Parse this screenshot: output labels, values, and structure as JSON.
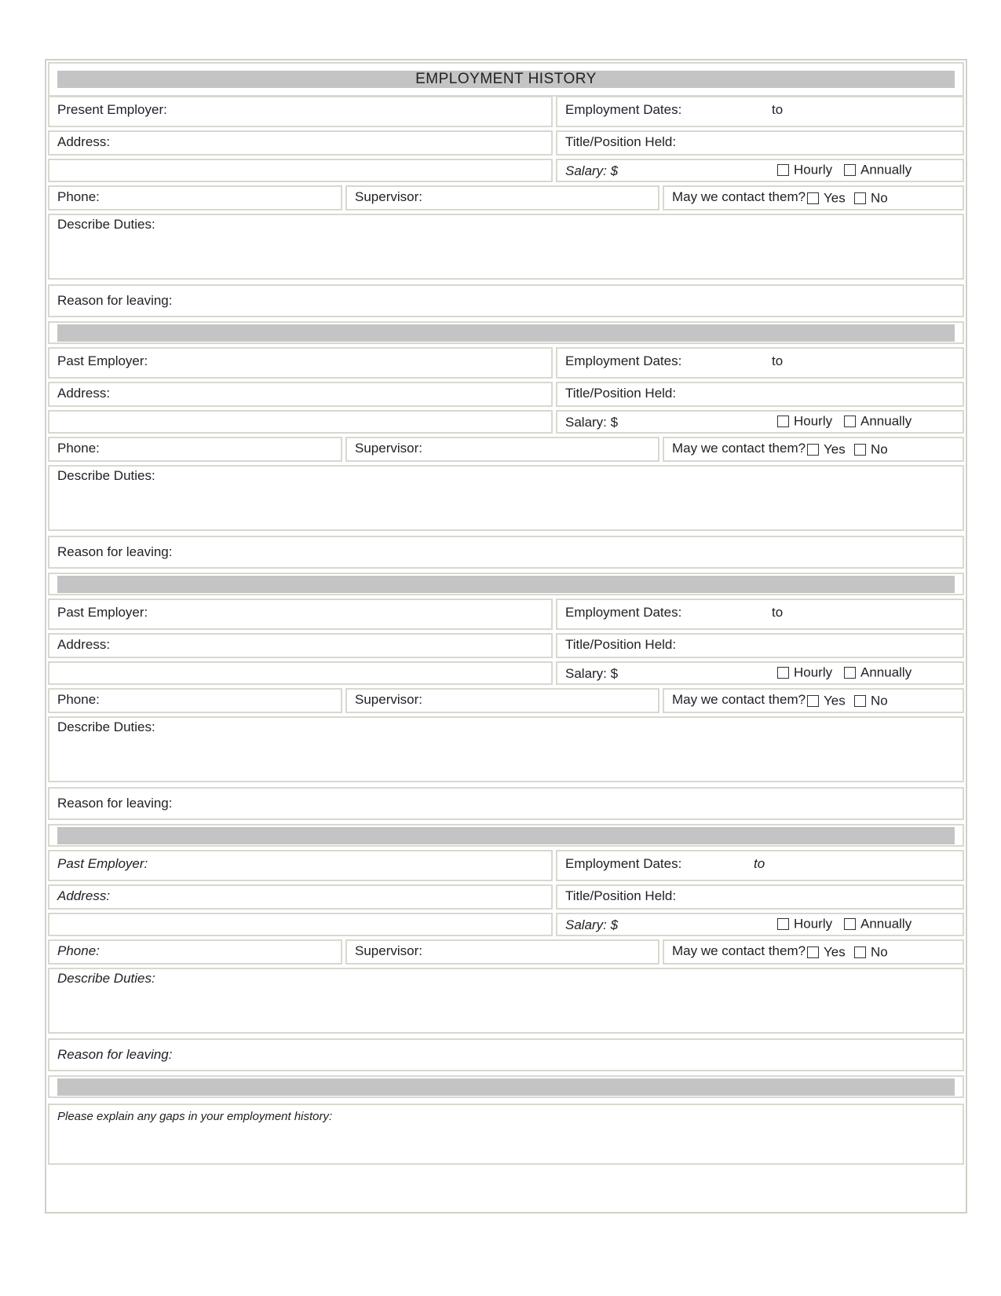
{
  "title": "EMPLOYMENT   HISTORY",
  "sections": [
    {
      "employer_label": "Present Employer:",
      "dates_label": "Employment Dates:",
      "to_label": "to",
      "address_label": "Address:",
      "title_label": "Title/Position Held:",
      "salary_label": "Salary: $",
      "hourly_label": "Hourly",
      "annually_label": "Annually",
      "phone_label": "Phone:",
      "supervisor_label": "Supervisor:",
      "contact_label": "May we contact them?",
      "yes_label": "Yes",
      "no_label": "No",
      "duties_label": "Describe Duties:",
      "reason_label": "Reason for leaving:"
    },
    {
      "employer_label": "Past Employer:",
      "dates_label": "Employment Dates:",
      "to_label": "to",
      "address_label": "Address:",
      "title_label": "Title/Position Held:",
      "salary_label": "Salary: $",
      "hourly_label": "Hourly",
      "annually_label": "Annually",
      "phone_label": "Phone:",
      "supervisor_label": "Supervisor:",
      "contact_label": "May we contact them?",
      "yes_label": "Yes",
      "no_label": "No",
      "duties_label": "Describe Duties:",
      "reason_label": "Reason for leaving:"
    },
    {
      "employer_label": "Past Employer:",
      "dates_label": "Employment Dates:",
      "to_label": "to",
      "address_label": "Address:",
      "title_label": "Title/Position Held:",
      "salary_label": "Salary: $",
      "hourly_label": "Hourly",
      "annually_label": "Annually",
      "phone_label": "Phone:",
      "supervisor_label": "Supervisor:",
      "contact_label": "May we contact them?",
      "yes_label": "Yes",
      "no_label": "No",
      "duties_label": "Describe Duties:",
      "reason_label": "Reason for leaving:"
    },
    {
      "employer_label": "Past Employer:",
      "dates_label": "Employment Dates:",
      "to_label": "to",
      "address_label": "Address:",
      "title_label": "Title/Position Held:",
      "salary_label": "Salary: $",
      "hourly_label": "Hourly",
      "annually_label": "Annually",
      "phone_label": "Phone:",
      "supervisor_label": "Supervisor:",
      "contact_label": "May we contact them?",
      "yes_label": "Yes",
      "no_label": "No",
      "duties_label": "Describe Duties:",
      "reason_label": "Reason for leaving:"
    }
  ],
  "gaps_label": "Please explain any gaps in your employment history:",
  "colors": {
    "bar": "#c4c4c4",
    "border": "#d8d8d0"
  }
}
